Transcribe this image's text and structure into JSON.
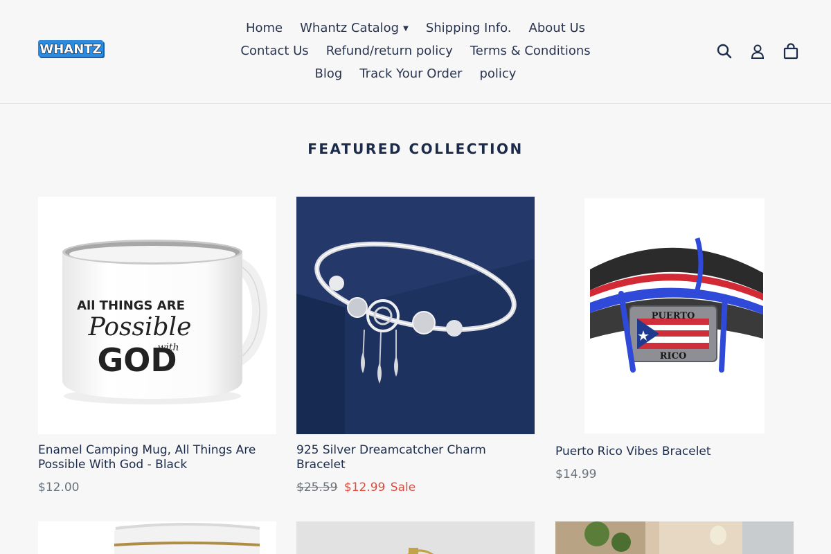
{
  "header": {
    "logo_text": "WHANTZ",
    "nav_rows": [
      [
        {
          "label": "Home"
        },
        {
          "label": "Whantz Catalog",
          "dropdown": true
        },
        {
          "label": "Shipping Info."
        },
        {
          "label": "About Us"
        }
      ],
      [
        {
          "label": "Contact Us"
        },
        {
          "label": "Refund/return policy"
        },
        {
          "label": "Terms & Conditions"
        }
      ],
      [
        {
          "label": "Blog"
        },
        {
          "label": "Track Your Order"
        },
        {
          "label": "policy"
        }
      ]
    ],
    "icons": [
      "search-icon",
      "account-icon",
      "cart-icon"
    ]
  },
  "section": {
    "title": "FEATURED COLLECTION"
  },
  "products": [
    {
      "title": "Enamel Camping Mug, All Things Are Possible With God - Black",
      "price": "$12.00",
      "mug_text": [
        "All THINGS ARE",
        "Possible",
        "with",
        "GOD"
      ]
    },
    {
      "title": "925 Silver Dreamcatcher Charm Bracelet",
      "old_price": "$25.59",
      "sale_price": "$12.99",
      "sale_label": "Sale"
    },
    {
      "title": "Puerto Rico Vibes Bracelet",
      "price": "$14.99",
      "plate_text": [
        "PUERTO",
        "RICO"
      ]
    }
  ],
  "colors": {
    "navy": "#1c2b4a",
    "sale": "#e04a3c",
    "price_gray": "#69727b",
    "bracelet_bg": "#1d325f"
  }
}
